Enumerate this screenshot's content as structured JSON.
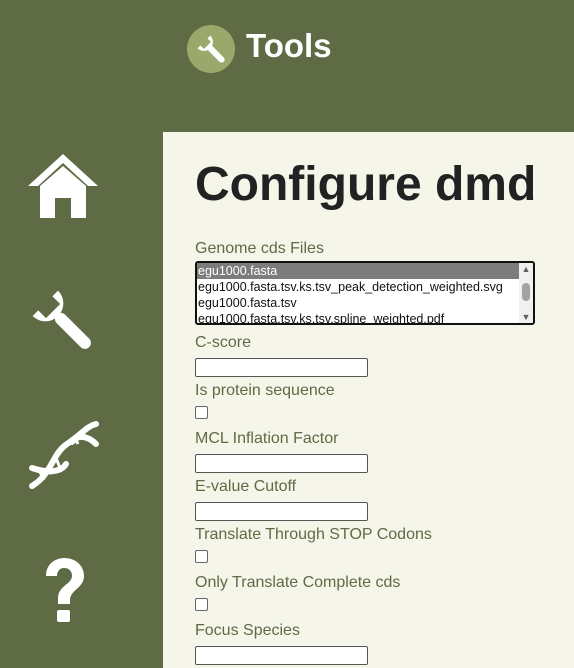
{
  "header": {
    "app_title": "Tools",
    "logo_icon": "wrench-icon",
    "accent_color": "#5f6b44"
  },
  "sidebar": {
    "items": [
      {
        "icon": "home-icon"
      },
      {
        "icon": "wrench-icon"
      },
      {
        "icon": "dna-icon"
      },
      {
        "icon": "question-icon"
      }
    ]
  },
  "main": {
    "title": "Configure dmd",
    "genome_files": {
      "label": "Genome cds Files",
      "options": [
        "egu1000.fasta",
        "egu1000.fasta.tsv.ks.tsv_peak_detection_weighted.svg",
        "egu1000.fasta.tsv",
        "egu1000.fasta.tsv.ks.tsv.spline_weighted.pdf"
      ],
      "selected": "egu1000.fasta"
    },
    "c_score": {
      "label": "C-score",
      "value": ""
    },
    "is_protein": {
      "label": "Is protein sequence",
      "checked": false
    },
    "mcl_inflation": {
      "label": "MCL Inflation Factor",
      "value": ""
    },
    "evalue_cutoff": {
      "label": "E-value Cutoff",
      "value": ""
    },
    "translate_stop": {
      "label": "Translate Through STOP Codons",
      "checked": false
    },
    "only_complete": {
      "label": "Only Translate Complete cds",
      "checked": false
    },
    "focus_species": {
      "label": "Focus Species",
      "value": ""
    }
  }
}
